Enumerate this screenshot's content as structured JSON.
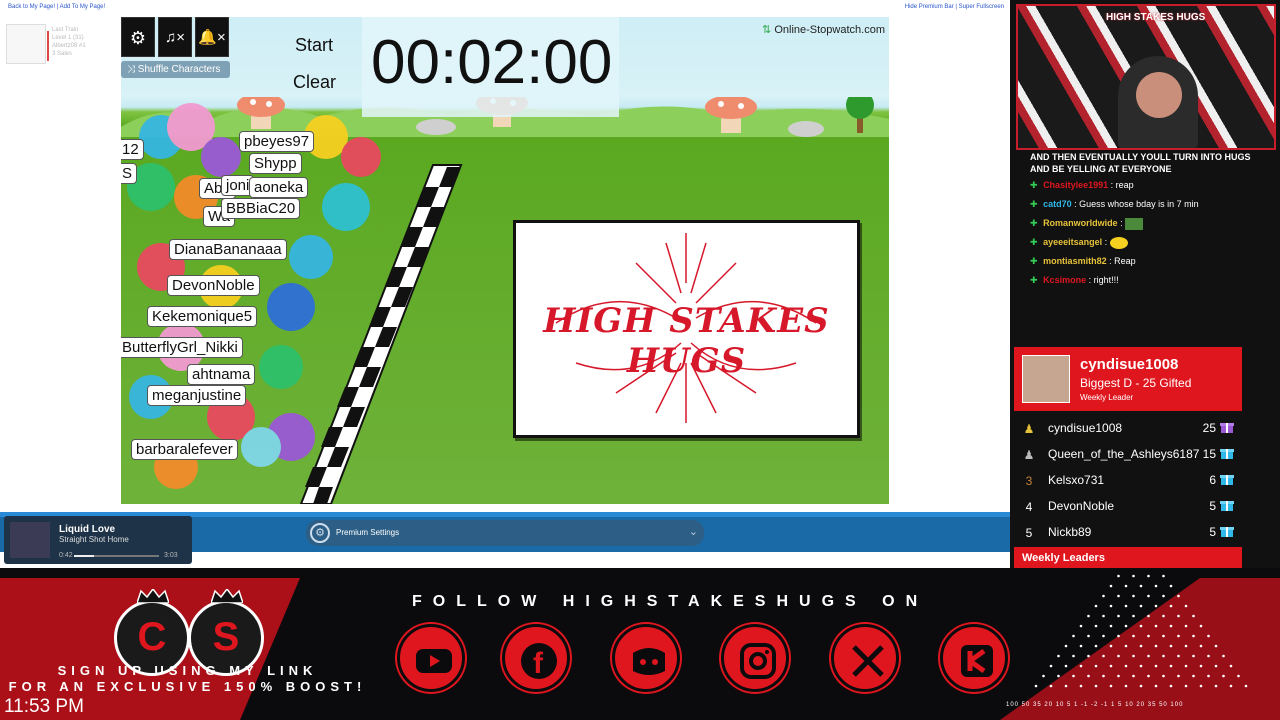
{
  "browser": {
    "top_left_links": "Back to My Page! | Add To My Page!",
    "top_right_links": "Hide Premium Bar | Super Fullscreen",
    "last_train": {
      "title": "Last Train",
      "level": "Level 1 (31)",
      "user": "Albertz08 #1",
      "sales": "3 Sales"
    }
  },
  "game": {
    "start_label": "Start",
    "clear_label": "Clear",
    "timer": "00:02:00",
    "shuffle_label": "Shuffle Characters",
    "brand": "Online-Stopwatch.com",
    "logo_text": "HIGH STAKES HUGS",
    "icons": [
      "gear-icon",
      "music-mute-icon",
      "bell-mute-icon"
    ],
    "racers": [
      "12",
      "S",
      "pbeyes97",
      "Shypp",
      "Abu",
      "joni",
      "aoneka",
      "Wa",
      "BBBiaC20",
      "DianaBananaaa",
      "DevonNoble",
      "Kekemonique5",
      "ButterflyGrl_Nikki",
      "ahtnama",
      "meganjustine",
      "barbaralefever"
    ]
  },
  "player": {
    "song": "Liquid Love",
    "artist": "Straight Shot Home",
    "time_current": "0:42",
    "time_total": "3:03",
    "progress": 0.23,
    "premium_label": "Premium Settings"
  },
  "webcam": {
    "overlay_text": "HIGH STAKES HUGS"
  },
  "chat": {
    "messages": [
      {
        "user": "",
        "text": "AND THEN EVENTUALLY YOULL TURN INTO HUGS AND BE YELLING AT EVERYONE",
        "color": "#ffffff"
      },
      {
        "user": "Chasitylee1991",
        "text": ": reap",
        "color": "#e0161f"
      },
      {
        "user": "catd70",
        "text": ": Guess whose bday is in 7 min",
        "color": "#2fb8e8"
      },
      {
        "user": "Romanworldwide",
        "text": ":",
        "color": "#e6c23a"
      },
      {
        "user": "ayeeeitsangel",
        "text": ":",
        "color": "#e6c23a"
      },
      {
        "user": "montiasmith82",
        "text": ": Reap",
        "color": "#e6c23a"
      },
      {
        "user": "Kcsimone",
        "text": ": right!!!",
        "color": "#e0161f"
      }
    ]
  },
  "leaderboard": {
    "top_name": "cyndisue1008",
    "top_subtitle": "Biggest D - 25 Gifted",
    "top_tag": "Weekly Leader",
    "rows": [
      {
        "rank": "1",
        "name": "cyndisue1008",
        "count": "25",
        "gift_color": "#9b59d6",
        "rank_color": "#e6c23a"
      },
      {
        "rank": "2",
        "name": "Queen_of_the_Ashleys6187",
        "count": "15",
        "gift_color": "#2fb8e8",
        "rank_color": "#bbbbbb"
      },
      {
        "rank": "3",
        "name": "Kelsxo731",
        "count": "6",
        "gift_color": "#2fb8e8",
        "rank_color": "#c7853a"
      },
      {
        "rank": "4",
        "name": "DevonNoble",
        "count": "5",
        "gift_color": "#2fb8e8",
        "rank_color": "#ffffff"
      },
      {
        "rank": "5",
        "name": "Nickb89",
        "count": "5",
        "gift_color": "#2fb8e8",
        "rank_color": "#ffffff"
      }
    ],
    "footer": "Weekly Leaders"
  },
  "footer": {
    "follow_text": "FOLLOW HIGHSTAKESHUGS ON",
    "social": [
      "youtube-icon",
      "facebook-icon",
      "discord-icon",
      "instagram-icon",
      "x-icon",
      "kick-icon"
    ],
    "signup_line1": "SIGN UP USING MY LINK",
    "signup_line2": "FOR AN EXCLUSIVE 150% BOOST!",
    "clock": "11:53 PM",
    "cs_letters": [
      "C",
      "S"
    ],
    "plinko_values": "100 50 35 20 10 5 1 -1 -2 -1 1 5 10 20 35 50 100"
  },
  "colors": {
    "accent": "#e0161f",
    "blue": "#1a6aa8",
    "grass": "#6fb23a"
  }
}
